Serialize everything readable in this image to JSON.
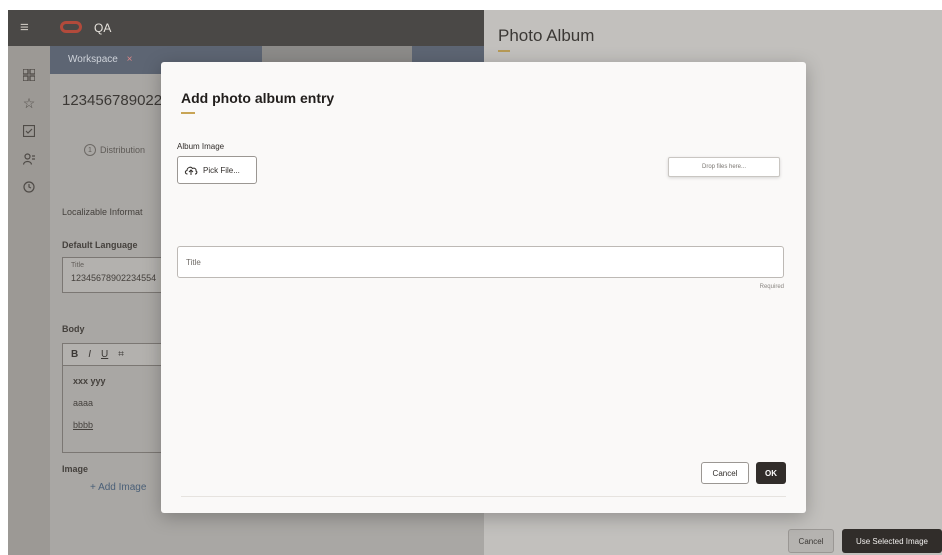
{
  "app": {
    "name": "QA",
    "menu_icon": "hamburger-menu-icon",
    "logo_icon": "oracle-logo-icon"
  },
  "rail": {
    "icons": [
      "grid-icon",
      "star-icon",
      "checklist-icon",
      "users-icon",
      "clock-icon"
    ]
  },
  "tabs": [
    {
      "label": "Workspace",
      "close": "×"
    }
  ],
  "background_page": {
    "id_title": "123456789022",
    "step_label": "Distribution",
    "section_heading": "Localizable Informat",
    "default_language_label": "Default Language",
    "title_field_label": "Title",
    "title_field_value": "12345678902234554",
    "body_label": "Body",
    "toolbar": [
      "B",
      "I",
      "U",
      "⌗"
    ],
    "body_lines": [
      "xxx yyy",
      "aaaa",
      "bbbb"
    ],
    "image_label": "Image",
    "add_image_link": "+ Add Image"
  },
  "album_panel": {
    "title": "Photo Album",
    "cancel_button": "Cancel",
    "use_selected_button": "Use Selected Image"
  },
  "dialog": {
    "title": "Add photo album entry",
    "album_image_label": "Album Image",
    "pick_file_button": "Pick File...",
    "drop_zone_text": "Drop files here...",
    "title_field_placeholder": "Title",
    "required_hint": "Required",
    "cancel_button": "Cancel",
    "ok_button": "OK"
  },
  "colors": {
    "accent_gold": "#c8a556",
    "primary_button": "#312d2a",
    "header_bg": "#4a4846"
  }
}
